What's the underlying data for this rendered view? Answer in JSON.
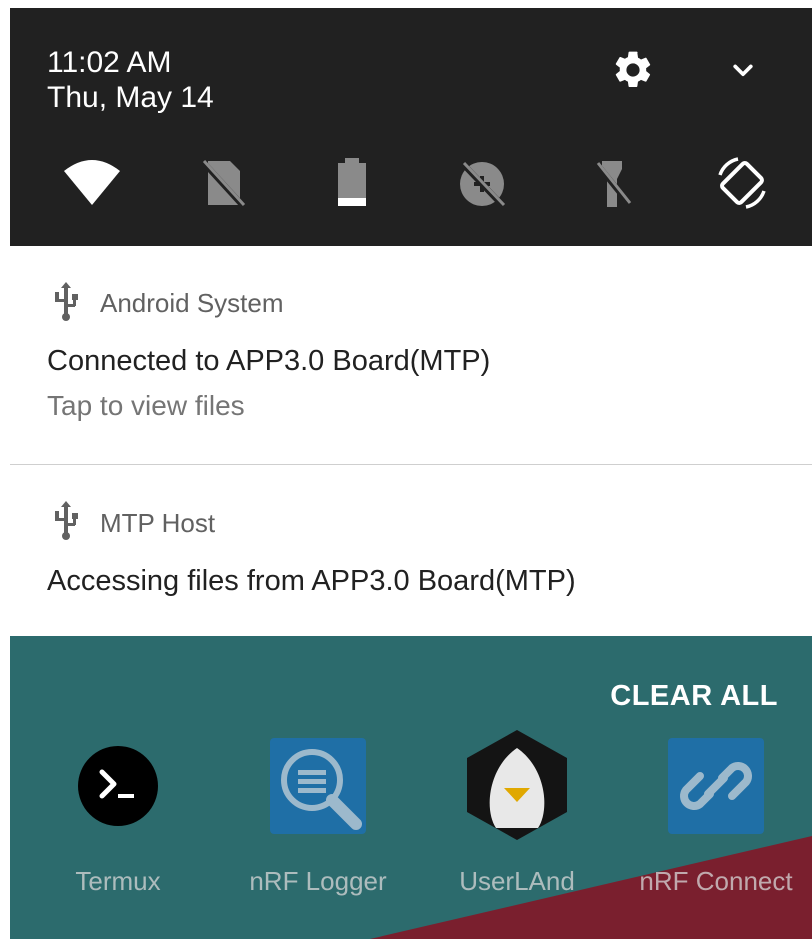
{
  "quick_settings": {
    "time": "11:02 AM",
    "date": "Thu, May 14",
    "settings_icon": "gear-icon",
    "expand_icon": "chevron-down-icon",
    "tiles": [
      {
        "name": "wifi",
        "icon": "wifi-icon",
        "active": true
      },
      {
        "name": "mobile-data",
        "icon": "no-sim-icon",
        "active": false
      },
      {
        "name": "battery-saver",
        "icon": "battery-icon",
        "active": true
      },
      {
        "name": "data-saver",
        "icon": "data-saver-off-icon",
        "active": false
      },
      {
        "name": "flashlight",
        "icon": "flashlight-off-icon",
        "active": false
      },
      {
        "name": "auto-rotate",
        "icon": "auto-rotate-icon",
        "active": true
      }
    ]
  },
  "notifications": [
    {
      "app": "Android System",
      "icon": "usb-icon",
      "title": "Connected to APP3.0 Board(MTP)",
      "text": "Tap to view files"
    },
    {
      "app": "MTP Host",
      "icon": "usb-icon",
      "title": "Accessing files from APP3.0 Board(MTP)"
    }
  ],
  "recents": {
    "clear_all": "CLEAR ALL",
    "apps": [
      {
        "label": "Termux",
        "icon": "terminal-icon"
      },
      {
        "label": "nRF Logger",
        "icon": "magnifier-log-icon"
      },
      {
        "label": "UserLAnd",
        "icon": "penguin-icon"
      },
      {
        "label": "nRF Connect",
        "icon": "link-icon"
      }
    ]
  },
  "colors": {
    "header_bg": "#212121",
    "wallpaper": "#2c6b6d",
    "wallpaper_accent": "#7a1f2e",
    "app_blue": "#1f6fa6"
  }
}
